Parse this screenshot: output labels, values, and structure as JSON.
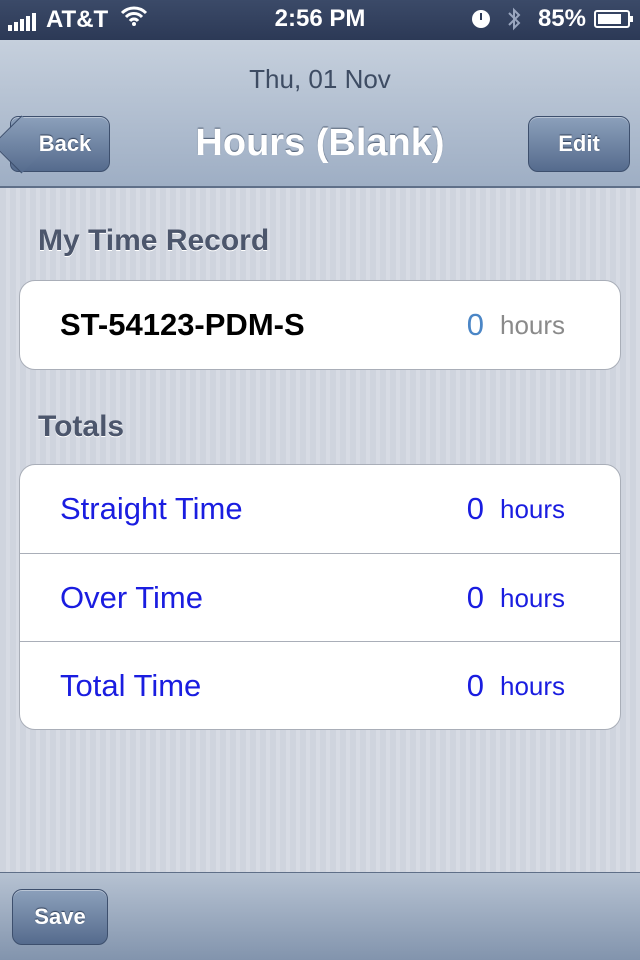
{
  "status_bar": {
    "carrier": "AT&T",
    "time": "2:56 PM",
    "battery": "85%",
    "battery_level": 0.85
  },
  "nav": {
    "date": "Thu, 01 Nov",
    "title": "Hours (Blank)",
    "back_label": "Back",
    "edit_label": "Edit"
  },
  "time_record": {
    "header": "My Time Record",
    "code": "ST-54123-PDM-S",
    "value": "0",
    "unit": "hours"
  },
  "totals": {
    "header": "Totals",
    "rows": [
      {
        "label": "Straight Time",
        "value": "0",
        "unit": "hours"
      },
      {
        "label": "Over Time",
        "value": "0",
        "unit": "hours"
      },
      {
        "label": "Total Time",
        "value": "0",
        "unit": "hours"
      }
    ]
  },
  "toolbar": {
    "save_label": "Save"
  },
  "colors": {
    "link_blue": "#1a1de0",
    "value_blue": "#4b86c6",
    "nav_bar": "#9eaec4"
  }
}
